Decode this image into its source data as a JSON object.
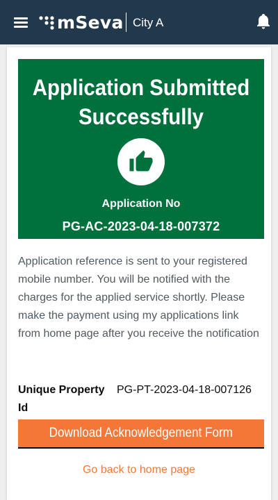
{
  "header": {
    "logo_text": "mSeva",
    "city": "City A",
    "icons": {
      "menu": "menu-icon",
      "logo": "mseva-dots-icon",
      "notification": "bell-icon"
    }
  },
  "banner": {
    "title_line1": "Application Submitted",
    "title_line2": "Successfully",
    "icon": "thumbs-up-icon",
    "app_no_label": "Application No",
    "app_no": "PG-AC-2023-04-18-007372"
  },
  "message": "Application reference is sent to your registered mobile number. You will be notified with the charges for the applied service shortly. Please make the payment using my applications link from home page after you receive the notification",
  "property": {
    "label": "Unique Property Id",
    "value": "PG-PT-2023-04-18-007126"
  },
  "actions": {
    "download_label": "Download Acknowledgement Form",
    "home_link_label": "Go back to home page"
  },
  "colors": {
    "header_bg": "#22394d",
    "success_green": "#00703c",
    "accent_orange": "#f47738",
    "text_secondary": "#505a5f"
  }
}
